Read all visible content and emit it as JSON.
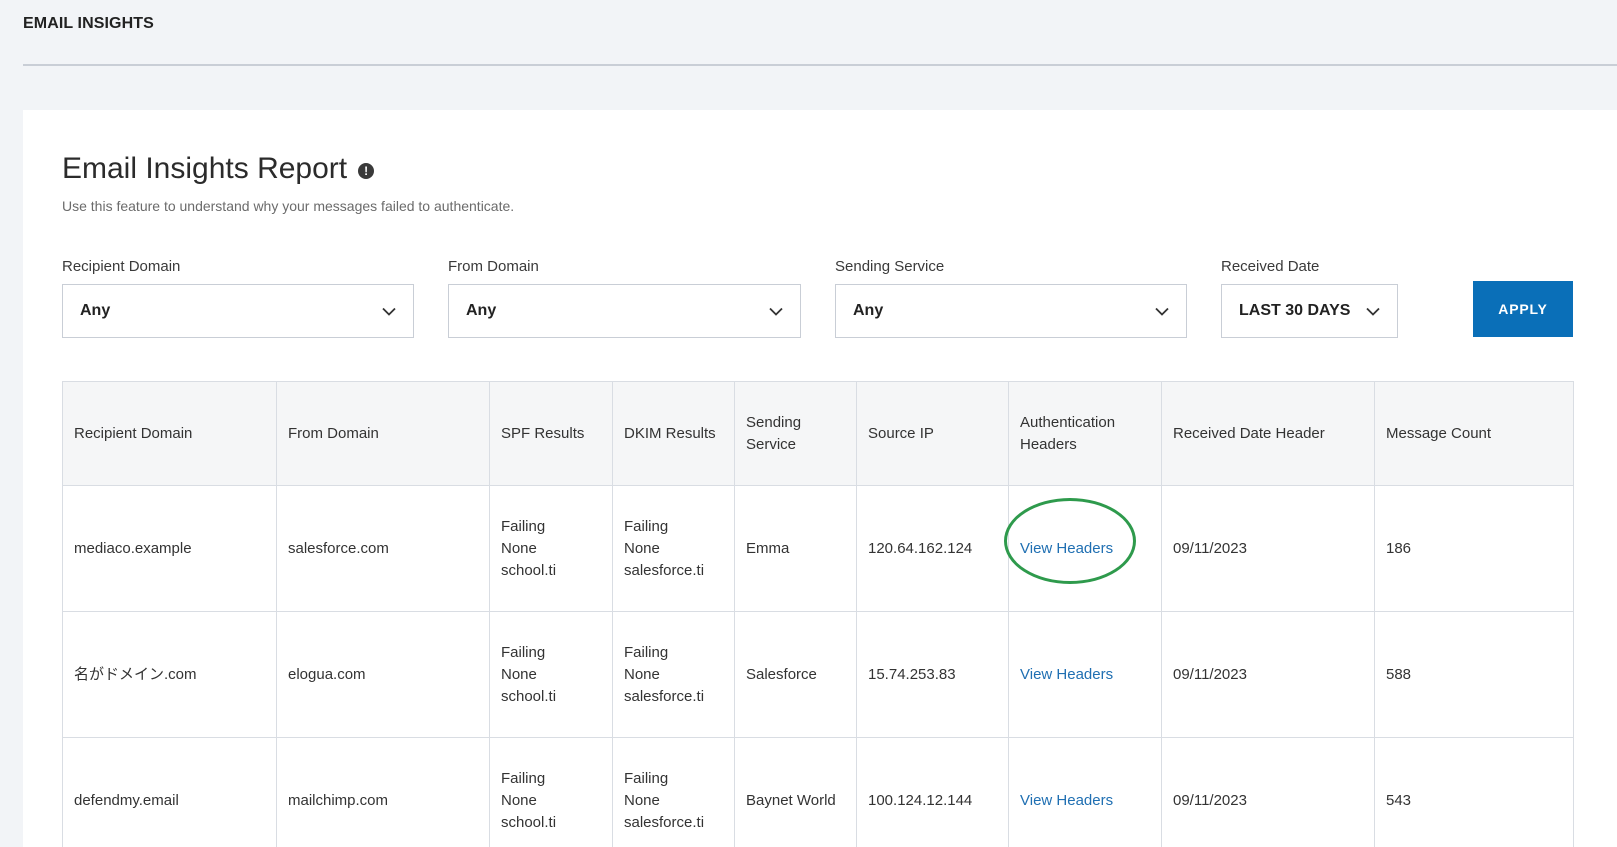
{
  "header": {
    "title": "EMAIL INSIGHTS"
  },
  "report": {
    "title": "Email Insights Report",
    "info_icon": "!",
    "subtitle": "Use this feature to understand why your messages failed to authenticate."
  },
  "filters": [
    {
      "label": "Recipient Domain",
      "value": "Any"
    },
    {
      "label": "From Domain",
      "value": "Any"
    },
    {
      "label": "Sending Service",
      "value": "Any"
    },
    {
      "label": "Received Date",
      "value": "LAST 30 DAYS"
    }
  ],
  "apply_label": "APPLY",
  "table": {
    "columns": [
      "Recipient Domain",
      "From Domain",
      "SPF Results",
      "DKIM Results",
      "Sending Service",
      "Source IP",
      "Authentication Headers",
      "Received Date Header",
      "Message Count"
    ],
    "rows": [
      {
        "recipient_domain": "mediaco.example",
        "from_domain": "salesforce.com",
        "spf": [
          "Failing",
          "None",
          "school.ti"
        ],
        "dkim": [
          "Failing",
          "None",
          "salesforce.ti"
        ],
        "sending_service": "Emma",
        "source_ip": "120.64.162.124",
        "auth_headers": "View Headers",
        "received_date": "09/11/2023",
        "message_count": "186"
      },
      {
        "recipient_domain": "名がドメイン.com",
        "from_domain": "elogua.com",
        "spf": [
          "Failing",
          "None",
          "school.ti"
        ],
        "dkim": [
          "Failing",
          "None",
          "salesforce.ti"
        ],
        "sending_service": "Salesforce",
        "source_ip": "15.74.253.83",
        "auth_headers": "View Headers",
        "received_date": "09/11/2023",
        "message_count": "588"
      },
      {
        "recipient_domain": "defendmy.email",
        "from_domain": "mailchimp.com",
        "spf": [
          "Failing",
          "None",
          "school.ti"
        ],
        "dkim": [
          "Failing",
          "None",
          "salesforce.ti"
        ],
        "sending_service": "Baynet World",
        "source_ip": "100.124.12.144",
        "auth_headers": "View Headers",
        "received_date": "09/11/2023",
        "message_count": "543"
      }
    ]
  },
  "annotation": {
    "highlight_color": "#2e9a4c",
    "accent": "#0a6fb8"
  }
}
